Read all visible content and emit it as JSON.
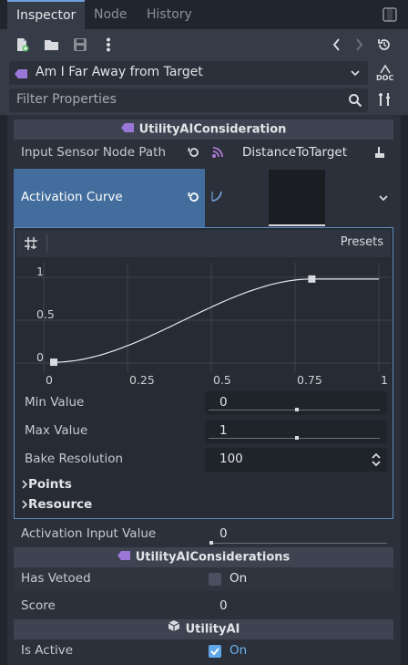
{
  "tabs": [
    {
      "label": "Inspector",
      "active": true
    },
    {
      "label": "Node",
      "active": false
    },
    {
      "label": "History",
      "active": false
    }
  ],
  "toolbar": {
    "icons": [
      "new-resource-icon",
      "open-icon",
      "save-icon",
      "more-icon",
      "back-icon",
      "forward-icon",
      "history-icon"
    ]
  },
  "object_selector": {
    "value": "Am I Far Away from Target",
    "doc_label": "DOC"
  },
  "filter": {
    "placeholder": "Filter Properties"
  },
  "sections": {
    "consideration": "UtilityAIConsideration",
    "considerations": "UtilityAIConsiderations",
    "utility_ai": "UtilityAI"
  },
  "input_sensor": {
    "label": "Input Sensor Node Path",
    "value": "DistanceToTarget"
  },
  "activation_curve": {
    "label": "Activation Curve"
  },
  "curve_editor": {
    "presets_label": "Presets",
    "y_ticks": [
      "1",
      "0.5",
      "0"
    ],
    "x_ticks": [
      "0",
      "0.25",
      "0.5",
      "0.75",
      "1"
    ]
  },
  "chart_data": {
    "type": "line",
    "x": [
      0.03,
      0.1,
      0.2,
      0.3,
      0.4,
      0.5,
      0.6,
      0.7,
      0.8
    ],
    "y": [
      0.01,
      0.04,
      0.14,
      0.3,
      0.48,
      0.66,
      0.82,
      0.94,
      0.98
    ],
    "points": [
      {
        "x": 0.03,
        "y": 0.01
      },
      {
        "x": 0.8,
        "y": 0.98
      }
    ],
    "xlim": [
      0,
      1
    ],
    "ylim": [
      0,
      1
    ],
    "grid": true
  },
  "curve_props": {
    "min_value": {
      "label": "Min Value",
      "value": "0"
    },
    "max_value": {
      "label": "Max Value",
      "value": "1"
    },
    "bake_resolution": {
      "label": "Bake Resolution",
      "value": "100"
    },
    "points_label": "Points",
    "resource_label": "Resource"
  },
  "activation_input": {
    "label": "Activation Input Value",
    "value": "0"
  },
  "has_vetoed": {
    "label": "Has Vetoed",
    "checked": false,
    "value": "On"
  },
  "score": {
    "label": "Score",
    "value": "0"
  },
  "is_active": {
    "label": "Is Active",
    "checked": true,
    "value": "On"
  },
  "colors": {
    "accent": "#6ea0d8",
    "selected_row": "#426d9c",
    "check_on": "#5fa7e8",
    "class_icon": "#9a77d6"
  }
}
